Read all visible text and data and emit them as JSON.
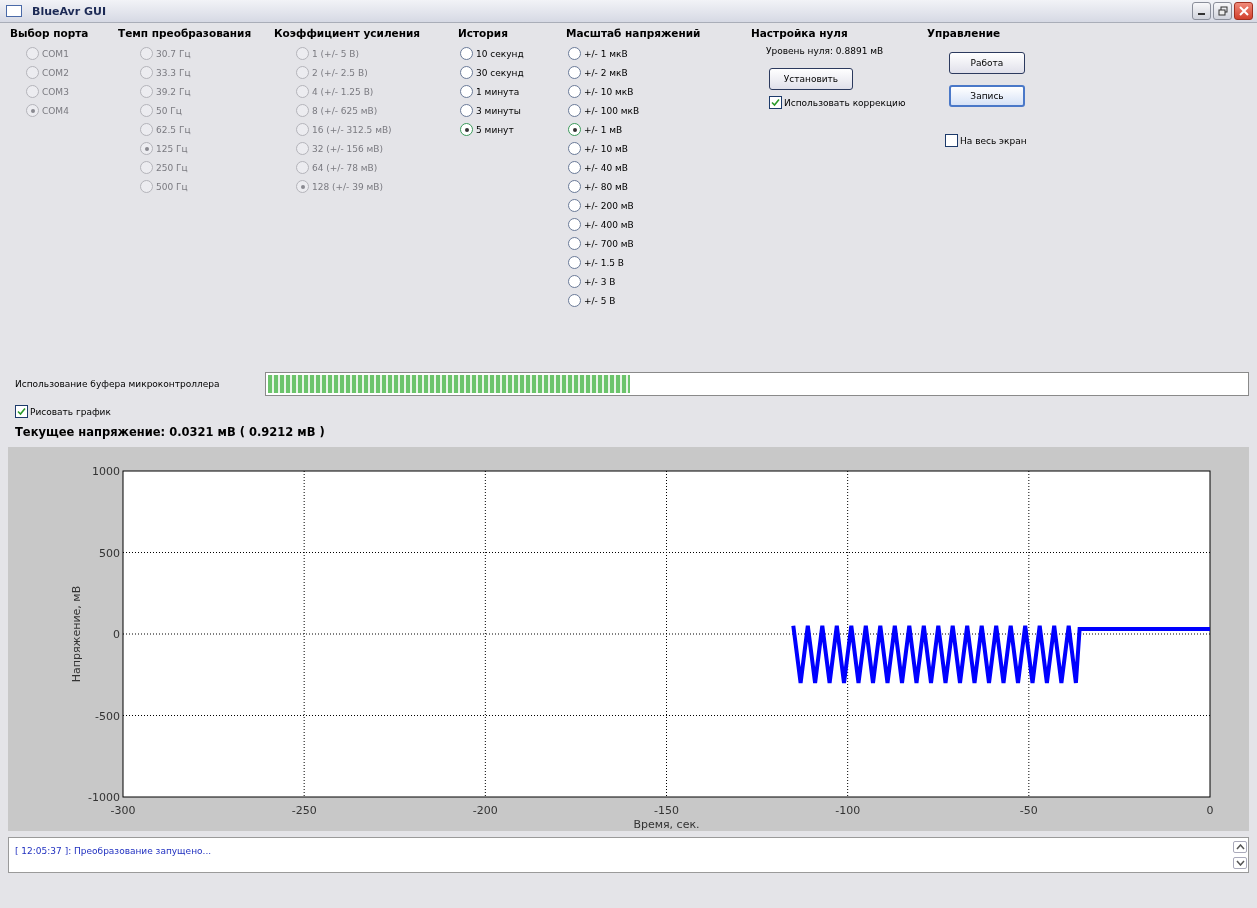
{
  "window": {
    "title": "BlueAvr GUI"
  },
  "groups": [
    {
      "title": "Выбор порта",
      "disabled": true,
      "options": [
        {
          "label": "COM1",
          "selected": false
        },
        {
          "label": "COM2",
          "selected": false
        },
        {
          "label": "COM3",
          "selected": false
        },
        {
          "label": "COM4",
          "selected": true
        }
      ]
    },
    {
      "title": "Темп преобразования",
      "disabled": true,
      "options": [
        {
          "label": "30.7 Гц",
          "selected": false
        },
        {
          "label": "33.3 Гц",
          "selected": false
        },
        {
          "label": "39.2 Гц",
          "selected": false
        },
        {
          "label": "50 Гц",
          "selected": false
        },
        {
          "label": "62.5 Гц",
          "selected": false
        },
        {
          "label": "125 Гц",
          "selected": true
        },
        {
          "label": "250 Гц",
          "selected": false
        },
        {
          "label": "500 Гц",
          "selected": false
        }
      ]
    },
    {
      "title": "Коэффициент усиления",
      "disabled": true,
      "options": [
        {
          "label": "1 (+/- 5 В)",
          "selected": false
        },
        {
          "label": "2 (+/- 2.5 В)",
          "selected": false
        },
        {
          "label": "4 (+/- 1.25 В)",
          "selected": false
        },
        {
          "label": "8 (+/- 625 мВ)",
          "selected": false
        },
        {
          "label": "16 (+/- 312.5 мВ)",
          "selected": false
        },
        {
          "label": "32 (+/- 156 мВ)",
          "selected": false
        },
        {
          "label": "64 (+/- 78 мВ)",
          "selected": false
        },
        {
          "label": "128 (+/- 39 мВ)",
          "selected": true
        }
      ]
    },
    {
      "title": "История",
      "disabled": false,
      "options": [
        {
          "label": "10 секунд",
          "selected": false
        },
        {
          "label": "30 секунд",
          "selected": false
        },
        {
          "label": "1 минута",
          "selected": false
        },
        {
          "label": "3 минуты",
          "selected": false
        },
        {
          "label": "5 минут",
          "selected": true
        }
      ]
    },
    {
      "title": "Масштаб напряжений",
      "disabled": false,
      "options": [
        {
          "label": "+/- 1 мкВ",
          "selected": false
        },
        {
          "label": "+/- 2 мкВ",
          "selected": false
        },
        {
          "label": "+/- 10 мкВ",
          "selected": false
        },
        {
          "label": "+/- 100 мкВ",
          "selected": false
        },
        {
          "label": "+/- 1 мВ",
          "selected": true
        },
        {
          "label": "+/- 10 мВ",
          "selected": false
        },
        {
          "label": "+/- 40 мВ",
          "selected": false
        },
        {
          "label": "+/- 80 мВ",
          "selected": false
        },
        {
          "label": "+/- 200 мВ",
          "selected": false
        },
        {
          "label": "+/- 400 мВ",
          "selected": false
        },
        {
          "label": "+/- 700 мВ",
          "selected": false
        },
        {
          "label": "+/- 1.5 В",
          "selected": false
        },
        {
          "label": "+/- 3 В",
          "selected": false
        },
        {
          "label": "+/- 5 В",
          "selected": false
        }
      ]
    }
  ],
  "zero": {
    "title": "Настройка нуля",
    "level_text": "Уровень нуля: 0.8891 мВ",
    "button": "Установить",
    "correction": {
      "label": "Использовать коррекцию",
      "checked": true
    }
  },
  "control": {
    "title": "Управление",
    "buttons": [
      {
        "label": "Работа",
        "focused": false
      },
      {
        "label": "Запись",
        "focused": true
      }
    ],
    "fullscreen": {
      "label": "На весь экран",
      "checked": false
    }
  },
  "buffer": {
    "label": "Использование буфера микроконтроллера",
    "level": 0.37
  },
  "draw_graph": {
    "label": "Рисовать график",
    "checked": true
  },
  "current_voltage": "Текущее напряжение: 0.0321 мВ ( 0.9212 мВ )",
  "chart_data": {
    "type": "line",
    "grid": true,
    "xlabel": "Время, сек.",
    "ylabel": "Напряжение, мВ",
    "xlim": [
      -300,
      0
    ],
    "ylim": [
      -1000,
      1000
    ],
    "xticks": [
      -300,
      -250,
      -200,
      -150,
      -100,
      -50,
      0
    ],
    "yticks": [
      -1000,
      -500,
      0,
      500,
      1000
    ],
    "x": [
      -115,
      -113,
      -111,
      -109,
      -107,
      -105,
      -103,
      -101,
      -99,
      -97,
      -95,
      -93,
      -91,
      -89,
      -87,
      -85,
      -83,
      -81,
      -79,
      -77,
      -75,
      -73,
      -71,
      -69,
      -67,
      -65,
      -63,
      -61,
      -59,
      -57,
      -55,
      -53,
      -51,
      -49,
      -47,
      -45,
      -43,
      -41,
      -39,
      -37,
      -36,
      0
    ],
    "series": [
      {
        "color": "#0000ff",
        "values": [
          50,
          -300,
          50,
          -300,
          50,
          -300,
          50,
          -300,
          50,
          -300,
          50,
          -300,
          50,
          -300,
          50,
          -300,
          50,
          -300,
          50,
          -300,
          50,
          -300,
          50,
          -300,
          50,
          -300,
          50,
          -300,
          50,
          -300,
          50,
          -300,
          50,
          -300,
          50,
          -300,
          50,
          -300,
          50,
          -300,
          30,
          30
        ]
      }
    ]
  },
  "log": [
    {
      "time": "[ 12:05:37 ]",
      "text": ": Преобразование запущено..."
    }
  ]
}
